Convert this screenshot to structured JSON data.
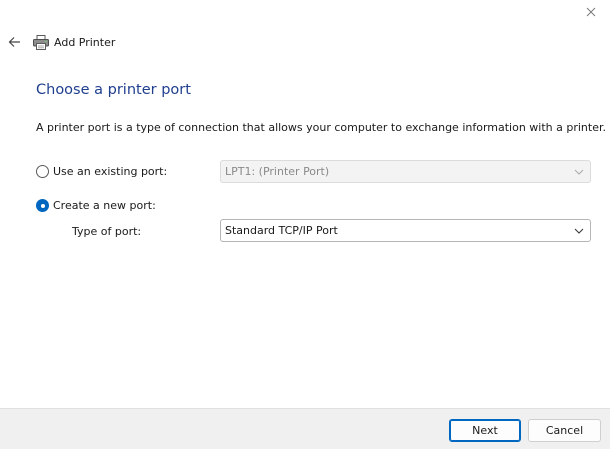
{
  "header": {
    "wizard_title": "Add Printer",
    "back_icon": "arrow-left-icon",
    "printer_icon": "printer-icon",
    "close_icon": "close-icon"
  },
  "page": {
    "heading": "Choose a printer port",
    "description": "A printer port is a type of connection that allows your computer to exchange information with a printer."
  },
  "options": {
    "existing": {
      "label": "Use an existing port:",
      "selected": false,
      "select_value": "LPT1: (Printer Port)",
      "enabled": false
    },
    "create": {
      "label": "Create a new port:",
      "selected": true,
      "type_label": "Type of port:",
      "select_value": "Standard TCP/IP Port",
      "enabled": true
    }
  },
  "footer": {
    "next_label": "Next",
    "cancel_label": "Cancel"
  },
  "colors": {
    "accent": "#0067c0",
    "heading": "#1f3e8f",
    "footer_bg": "#f0f0f0"
  }
}
